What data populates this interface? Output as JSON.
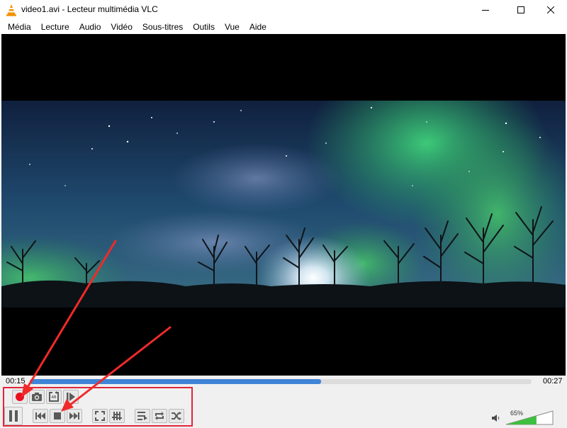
{
  "window": {
    "title": "video1.avi - Lecteur multimédia VLC",
    "icon": "vlc-cone-icon"
  },
  "menu": [
    {
      "label": "Média"
    },
    {
      "label": "Lecture"
    },
    {
      "label": "Audio"
    },
    {
      "label": "Vidéo"
    },
    {
      "label": "Sous-titres"
    },
    {
      "label": "Outils"
    },
    {
      "label": "Vue"
    },
    {
      "label": "Aide"
    }
  ],
  "playback": {
    "elapsed": "00:15",
    "total": "00:27",
    "progress_fraction": 0.58
  },
  "advanced_controls": [
    "record-icon",
    "snapshot-icon",
    "ab-loop-icon",
    "frame-step-icon"
  ],
  "main_controls": [
    "pause-icon",
    "previous-icon",
    "stop-icon",
    "next-icon",
    "fullscreen-icon",
    "extended-settings-icon",
    "playlist-icon",
    "loop-icon",
    "shuffle-icon"
  ],
  "volume": {
    "label": "65%",
    "level_fraction": 0.65
  },
  "colors": {
    "record": "#e8101e",
    "seek_fill": "#3f84d6",
    "volume_fill": "#3fbf3f",
    "highlight": "#e0263b",
    "arrow": "#f02a2a"
  }
}
